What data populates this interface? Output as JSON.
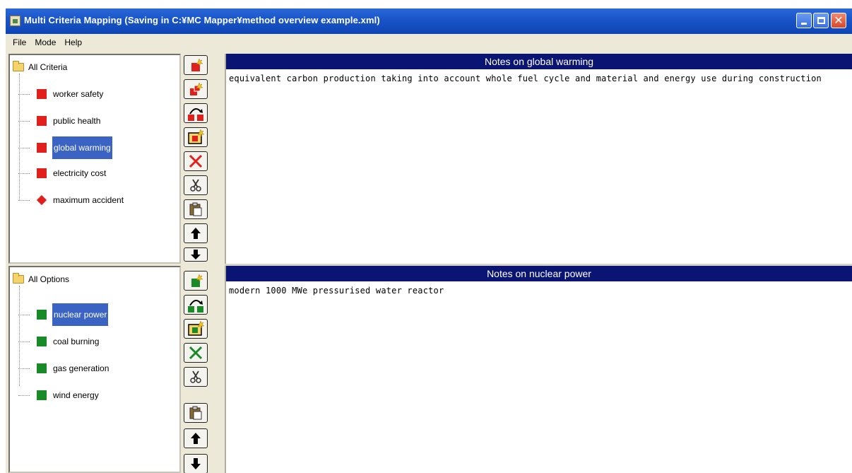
{
  "window": {
    "title": "Multi Criteria Mapping (Saving in C:¥MC Mapper¥method overview example.xml)"
  },
  "menu": [
    {
      "label": "File"
    },
    {
      "label": "Mode"
    },
    {
      "label": "Help"
    }
  ],
  "criteria_tree": {
    "root_label": "All Criteria",
    "items": [
      {
        "label": "worker safety",
        "shape": "square",
        "selected": false
      },
      {
        "label": "public health",
        "shape": "square",
        "selected": false
      },
      {
        "label": "global warming",
        "shape": "square",
        "selected": true
      },
      {
        "label": "electricity cost",
        "shape": "square",
        "selected": false
      },
      {
        "label": "maximum accident",
        "shape": "diamond",
        "selected": false
      }
    ]
  },
  "options_tree": {
    "root_label": "All Options",
    "items": [
      {
        "label": "nuclear power",
        "selected": true
      },
      {
        "label": "coal burning",
        "selected": false
      },
      {
        "label": "gas generation",
        "selected": false
      },
      {
        "label": "wind energy",
        "selected": false
      }
    ]
  },
  "criteria_notes": {
    "header": "Notes on global warming",
    "text": "equivalent carbon production taking into account whole fuel cycle and material and energy use during construction"
  },
  "options_notes": {
    "header": "Notes on nuclear power",
    "text": "modern 1000 MWe pressurised water reactor"
  },
  "toolbar_icons": {
    "criteria": [
      "new-criterion-icon",
      "new-sub-criterion-icon",
      "group-criteria-icon",
      "add-criterion-group-icon",
      "delete-criterion-icon",
      "cut-icon",
      "paste-icon",
      "move-up-icon",
      "move-down-icon"
    ],
    "options": [
      "new-option-icon",
      "group-options-icon",
      "add-option-group-icon",
      "delete-option-icon",
      "cut-icon",
      "paste-icon",
      "move-up-icon",
      "move-down-icon"
    ]
  },
  "colors": {
    "title_bar": "#1a56c9",
    "notes_header": "#0a1473",
    "selection": "#3a63c4",
    "criteria_node": "#e0201c",
    "options_node": "#188a28"
  }
}
